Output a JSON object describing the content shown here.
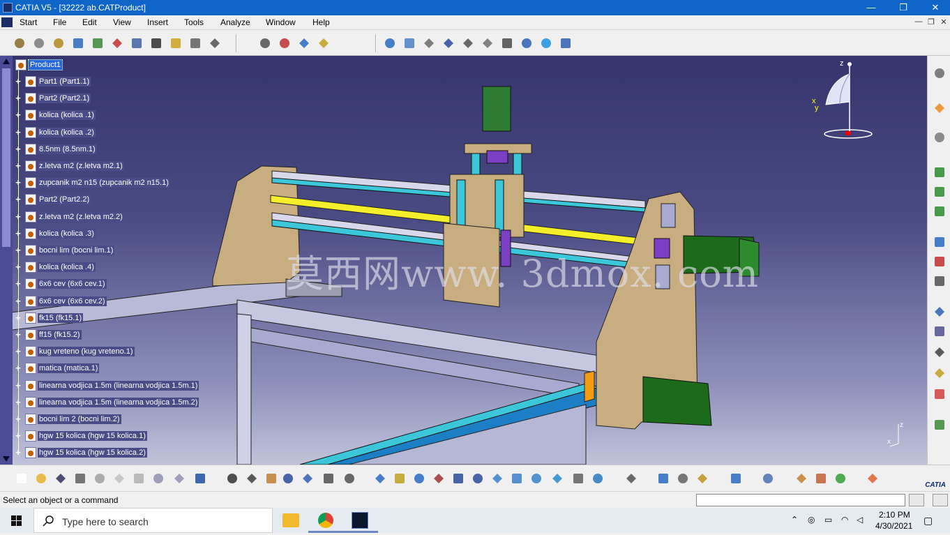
{
  "window": {
    "title": "CATIA V5 - [32222 ab.CATProduct]",
    "minimize": "—",
    "maximize": "❐",
    "close": "✕"
  },
  "menubar": {
    "items": [
      "Start",
      "File",
      "Edit",
      "View",
      "Insert",
      "Tools",
      "Analyze",
      "Window",
      "Help"
    ],
    "mdi": [
      "—",
      "❐",
      "✕"
    ]
  },
  "tree": {
    "root": "Product1",
    "nodes": [
      "Part1 (Part1.1)",
      "Part2 (Part2.1)",
      "kolica  (kolica .1)",
      "kolica  (kolica .2)",
      "8.5nm (8.5nm.1)",
      "z.letva m2 (z.letva m2.1)",
      "zupcanik m2 n15 (zupcanik m2 n15.1)",
      "Part2 (Part2.2)",
      "z.letva m2 (z.letva m2.2)",
      "kolica  (kolica .3)",
      "bocni lim (bocni lim.1)",
      "kolica  (kolica .4)",
      "6x6 cev (6x6 cev.1)",
      "6x6 cev (6x6 cev.2)",
      "fk15 (fk15.1)",
      "ff15 (fk15.2)",
      "kug vreteno (kug vreteno.1)",
      "matica (matica.1)",
      "linearna vodjica 1.5m (linearna vodjica 1.5m.1)",
      "linearna vodjica 1.5m (linearna vodjica 1.5m.2)",
      "bocni lim 2 (bocni lim.2)",
      "hgw 15 kolica (hgw 15 kolica.1)",
      "hgw 15 kolica (hgw 15 kolica.2)"
    ]
  },
  "compass": {
    "x": "x",
    "y": "y",
    "z": "z"
  },
  "axis_small": {
    "z": "z",
    "x": "x"
  },
  "watermark": "莫西网www. 3dmox. com",
  "status": {
    "message": "Select an object or a command"
  },
  "catia_logo": "CATIA",
  "taskbar": {
    "search_placeholder": "Type here to search",
    "time": "2:10 PM",
    "date": "4/30/2021"
  },
  "colors": {
    "titlebar": "#0f66c8",
    "viewport_top": "#35346c",
    "tree_label_bg": "#4a4c88",
    "root_selected": "#2a68d8"
  },
  "icons": {
    "toolbar_top": [
      "catalog-icon",
      "product-icon",
      "component-icon",
      "existing-component-icon",
      "replace-icon",
      "graph-tree-icon",
      "generate-numbering-icon",
      "bill-of-material-icon",
      "reset-icon",
      "manage-representations-icon",
      "publication-icon",
      "fix-icon",
      "snap-icon",
      "explode-icon",
      "clash-icon",
      "sectioning-icon",
      "distance-icon",
      "measure-icon",
      "annotation-icon",
      "apply-material-icon",
      "update-icon",
      "check-icon"
    ],
    "toolbar_bottom": [
      "new-icon",
      "open-icon",
      "save-icon",
      "print-icon",
      "cut-icon",
      "copy-icon",
      "paste-icon",
      "undo-icon",
      "redo-icon",
      "help-icon",
      "formula-icon",
      "knowledge-icon",
      "light-bulb-icon",
      "table-icon",
      "parameters-icon",
      "lock-icon",
      "macro-icon",
      "fly-mode-icon",
      "fit-all-icon",
      "pan-icon",
      "rotate-icon",
      "zoom-in-icon",
      "zoom-out-icon",
      "normal-view-icon",
      "multi-view-icon",
      "iso-view-icon",
      "shading-icon",
      "hide-show-icon",
      "swap-visible-icon",
      "capture-icon",
      "measure-between-icon",
      "measure-item-icon",
      "inertia-icon",
      "spiral-icon",
      "sketch-icon",
      "apply-material-bottom-icon",
      "render-icon",
      "plugin-icon",
      "grid-icon"
    ],
    "rightbar": [
      "gear-right-icon",
      "select-arrow-icon",
      "constraints-icon",
      "component-add-icon",
      "component-move-icon",
      "component-rebuild-icon",
      "engineering-connection-icon",
      "stack-icon",
      "smart-move-icon",
      "axis-icon",
      "abc-text-icon",
      "flag-note-icon",
      "weld-icon",
      "paint-icon",
      "catalog-right-icon"
    ]
  }
}
